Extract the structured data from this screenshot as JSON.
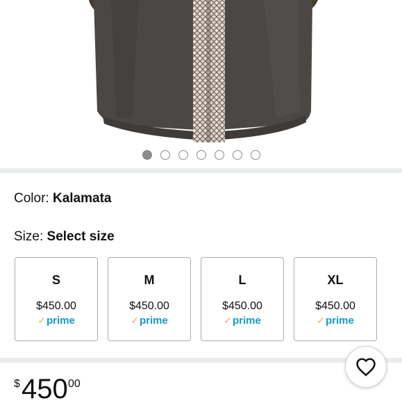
{
  "product": {
    "color_label": "Color: ",
    "color_value": "Kalamata",
    "size_label": "Size: ",
    "size_value": "Select size"
  },
  "carousel": {
    "count": 7,
    "active_index": 0
  },
  "sizes": [
    {
      "size": "S",
      "price": "$450.00",
      "badge": "prime"
    },
    {
      "size": "M",
      "price": "$450.00",
      "badge": "prime"
    },
    {
      "size": "L",
      "price": "$450.00",
      "badge": "prime"
    },
    {
      "size": "XL",
      "price": "$450.00",
      "badge": "prime"
    }
  ],
  "price": {
    "currency": "$",
    "whole": "450",
    "fraction": "00"
  },
  "icons": {
    "wishlist": "heart-icon",
    "prime_check": "check-icon"
  },
  "colors": {
    "prime": "#1399c7",
    "prime_check": "#f3a847"
  }
}
